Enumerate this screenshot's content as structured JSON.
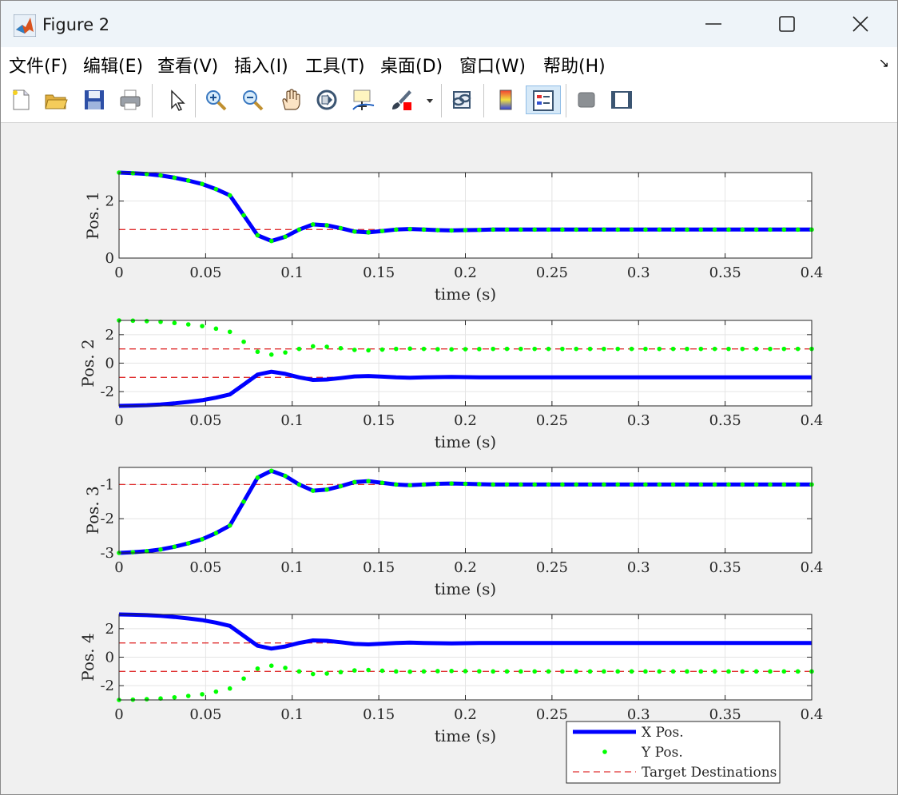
{
  "window": {
    "title": "Figure 2"
  },
  "menu": [
    "文件(F)",
    "编辑(E)",
    "查看(V)",
    "插入(I)",
    "工具(T)",
    "桌面(D)",
    "窗口(W)",
    "帮助(H)"
  ],
  "toolbar": [
    "new-figure-icon",
    "open-file-icon",
    "save-icon",
    "print-icon",
    "pointer-icon",
    "zoom-in-icon",
    "zoom-out-icon",
    "pan-icon",
    "rotate-3d-icon",
    "data-cursor-icon",
    "brush-icon",
    "link-plot-icon",
    "colorbar-icon",
    "legend-icon",
    "hide-plot-tools-icon",
    "show-plot-tools-icon"
  ],
  "colors": {
    "x_series": "#0000ff",
    "y_series": "#00ff00",
    "target": "#e03030"
  },
  "chart_data": [
    {
      "type": "line",
      "ylabel": "Pos. 1",
      "xlabel": "time (s)",
      "xlim": [
        0,
        0.4
      ],
      "ylim": [
        0,
        3
      ],
      "xticks": [
        "0",
        "0.05",
        "0.1",
        "0.15",
        "0.2",
        "0.25",
        "0.3",
        "0.35",
        "0.4"
      ],
      "yticks": [
        0,
        2
      ],
      "grid": true,
      "x": [
        0,
        0.008,
        0.016,
        0.024,
        0.032,
        0.04,
        0.048,
        0.056,
        0.064,
        0.072,
        0.08,
        0.088,
        0.096,
        0.104,
        0.112,
        0.12,
        0.128,
        0.136,
        0.144,
        0.152,
        0.16,
        0.168,
        0.176,
        0.184,
        0.192,
        0.2,
        0.208,
        0.216,
        0.224,
        0.232,
        0.24,
        0.248,
        0.256,
        0.264,
        0.272,
        0.28,
        0.288,
        0.296,
        0.304,
        0.312,
        0.32,
        0.328,
        0.336,
        0.344,
        0.352,
        0.36,
        0.368,
        0.376,
        0.384,
        0.392,
        0.4
      ],
      "series": [
        {
          "name": "X Pos.",
          "values": [
            3,
            2.98,
            2.95,
            2.9,
            2.82,
            2.72,
            2.6,
            2.42,
            2.2,
            1.5,
            0.8,
            0.6,
            0.75,
            1.0,
            1.18,
            1.15,
            1.05,
            0.93,
            0.9,
            0.95,
            1.0,
            1.02,
            1.0,
            0.98,
            0.97,
            0.98,
            0.99,
            1.0,
            1.0,
            1.0,
            1.0,
            1.0,
            1.0,
            1.0,
            1.0,
            1.0,
            1.0,
            1.0,
            1.0,
            1.0,
            1.0,
            1.0,
            1.0,
            1.0,
            1.0,
            1.0,
            1.0,
            1.0,
            1.0,
            1.0,
            1.0
          ]
        },
        {
          "name": "Y Pos.",
          "values": [
            3,
            2.98,
            2.95,
            2.9,
            2.82,
            2.72,
            2.6,
            2.42,
            2.2,
            1.5,
            0.8,
            0.6,
            0.75,
            1.0,
            1.18,
            1.15,
            1.05,
            0.93,
            0.9,
            0.95,
            1.0,
            1.02,
            1.0,
            0.98,
            0.97,
            0.98,
            0.99,
            1.0,
            1.0,
            1.0,
            1.0,
            1.0,
            1.0,
            1.0,
            1.0,
            1.0,
            1.0,
            1.0,
            1.0,
            1.0,
            1.0,
            1.0,
            1.0,
            1.0,
            1.0,
            1.0,
            1.0,
            1.0,
            1.0,
            1.0,
            1.0
          ]
        }
      ],
      "targets": [
        1
      ]
    },
    {
      "type": "line",
      "ylabel": "Pos. 2",
      "xlabel": "time (s)",
      "xlim": [
        0,
        0.4
      ],
      "ylim": [
        -3,
        3
      ],
      "xticks": [
        "0",
        "0.05",
        "0.1",
        "0.15",
        "0.2",
        "0.25",
        "0.3",
        "0.35",
        "0.4"
      ],
      "yticks": [
        -2,
        0,
        2
      ],
      "grid": true,
      "x": [
        0,
        0.008,
        0.016,
        0.024,
        0.032,
        0.04,
        0.048,
        0.056,
        0.064,
        0.072,
        0.08,
        0.088,
        0.096,
        0.104,
        0.112,
        0.12,
        0.128,
        0.136,
        0.144,
        0.152,
        0.16,
        0.168,
        0.176,
        0.184,
        0.192,
        0.2,
        0.208,
        0.216,
        0.224,
        0.232,
        0.24,
        0.248,
        0.256,
        0.264,
        0.272,
        0.28,
        0.288,
        0.296,
        0.304,
        0.312,
        0.32,
        0.328,
        0.336,
        0.344,
        0.352,
        0.36,
        0.368,
        0.376,
        0.384,
        0.392,
        0.4
      ],
      "series": [
        {
          "name": "X Pos.",
          "values": [
            -3,
            -2.98,
            -2.95,
            -2.9,
            -2.82,
            -2.72,
            -2.6,
            -2.42,
            -2.2,
            -1.5,
            -0.8,
            -0.6,
            -0.75,
            -1.0,
            -1.18,
            -1.15,
            -1.05,
            -0.93,
            -0.9,
            -0.95,
            -1.0,
            -1.02,
            -1.0,
            -0.98,
            -0.97,
            -0.98,
            -0.99,
            -1.0,
            -1.0,
            -1.0,
            -1.0,
            -1.0,
            -1.0,
            -1.0,
            -1.0,
            -1.0,
            -1.0,
            -1.0,
            -1.0,
            -1.0,
            -1.0,
            -1.0,
            -1.0,
            -1.0,
            -1.0,
            -1.0,
            -1.0,
            -1.0,
            -1.0,
            -1.0,
            -1.0
          ]
        },
        {
          "name": "Y Pos.",
          "values": [
            3,
            2.98,
            2.95,
            2.9,
            2.82,
            2.72,
            2.6,
            2.42,
            2.2,
            1.5,
            0.8,
            0.6,
            0.75,
            1.0,
            1.18,
            1.15,
            1.05,
            0.93,
            0.9,
            0.95,
            1.0,
            1.02,
            1.0,
            0.98,
            0.97,
            0.98,
            0.99,
            1.0,
            1.0,
            1.0,
            1.0,
            1.0,
            1.0,
            1.0,
            1.0,
            1.0,
            1.0,
            1.0,
            1.0,
            1.0,
            1.0,
            1.0,
            1.0,
            1.0,
            1.0,
            1.0,
            1.0,
            1.0,
            1.0,
            1.0,
            1.0
          ]
        }
      ],
      "targets": [
        1,
        -1
      ]
    },
    {
      "type": "line",
      "ylabel": "Pos. 3",
      "xlabel": "time (s)",
      "xlim": [
        0,
        0.4
      ],
      "ylim": [
        -3,
        -0.5
      ],
      "xticks": [
        "0",
        "0.05",
        "0.1",
        "0.15",
        "0.2",
        "0.25",
        "0.3",
        "0.35",
        "0.4"
      ],
      "yticks": [
        -3,
        -2,
        -1
      ],
      "grid": true,
      "x": [
        0,
        0.008,
        0.016,
        0.024,
        0.032,
        0.04,
        0.048,
        0.056,
        0.064,
        0.072,
        0.08,
        0.088,
        0.096,
        0.104,
        0.112,
        0.12,
        0.128,
        0.136,
        0.144,
        0.152,
        0.16,
        0.168,
        0.176,
        0.184,
        0.192,
        0.2,
        0.208,
        0.216,
        0.224,
        0.232,
        0.24,
        0.248,
        0.256,
        0.264,
        0.272,
        0.28,
        0.288,
        0.296,
        0.304,
        0.312,
        0.32,
        0.328,
        0.336,
        0.344,
        0.352,
        0.36,
        0.368,
        0.376,
        0.384,
        0.392,
        0.4
      ],
      "series": [
        {
          "name": "X Pos.",
          "values": [
            -3,
            -2.98,
            -2.95,
            -2.9,
            -2.82,
            -2.72,
            -2.6,
            -2.42,
            -2.2,
            -1.5,
            -0.8,
            -0.6,
            -0.75,
            -1.0,
            -1.18,
            -1.15,
            -1.05,
            -0.93,
            -0.9,
            -0.95,
            -1.0,
            -1.02,
            -1.0,
            -0.98,
            -0.97,
            -0.98,
            -0.99,
            -1.0,
            -1.0,
            -1.0,
            -1.0,
            -1.0,
            -1.0,
            -1.0,
            -1.0,
            -1.0,
            -1.0,
            -1.0,
            -1.0,
            -1.0,
            -1.0,
            -1.0,
            -1.0,
            -1.0,
            -1.0,
            -1.0,
            -1.0,
            -1.0,
            -1.0,
            -1.0,
            -1.0
          ]
        },
        {
          "name": "Y Pos.",
          "values": [
            -3,
            -2.98,
            -2.95,
            -2.9,
            -2.82,
            -2.72,
            -2.6,
            -2.42,
            -2.2,
            -1.5,
            -0.8,
            -0.6,
            -0.75,
            -1.0,
            -1.18,
            -1.15,
            -1.05,
            -0.93,
            -0.9,
            -0.95,
            -1.0,
            -1.02,
            -1.0,
            -0.98,
            -0.97,
            -0.98,
            -0.99,
            -1.0,
            -1.0,
            -1.0,
            -1.0,
            -1.0,
            -1.0,
            -1.0,
            -1.0,
            -1.0,
            -1.0,
            -1.0,
            -1.0,
            -1.0,
            -1.0,
            -1.0,
            -1.0,
            -1.0,
            -1.0,
            -1.0,
            -1.0,
            -1.0,
            -1.0,
            -1.0,
            -1.0
          ]
        }
      ],
      "targets": [
        -1
      ]
    },
    {
      "type": "line",
      "ylabel": "Pos. 4",
      "xlabel": "time (s)",
      "xlim": [
        0,
        0.4
      ],
      "ylim": [
        -3,
        3
      ],
      "xticks": [
        "0",
        "0.05",
        "0.1",
        "0.15",
        "0.2",
        "0.25",
        "0.3",
        "0.35",
        "0.4"
      ],
      "yticks": [
        -2,
        0,
        2
      ],
      "grid": true,
      "x": [
        0,
        0.008,
        0.016,
        0.024,
        0.032,
        0.04,
        0.048,
        0.056,
        0.064,
        0.072,
        0.08,
        0.088,
        0.096,
        0.104,
        0.112,
        0.12,
        0.128,
        0.136,
        0.144,
        0.152,
        0.16,
        0.168,
        0.176,
        0.184,
        0.192,
        0.2,
        0.208,
        0.216,
        0.224,
        0.232,
        0.24,
        0.248,
        0.256,
        0.264,
        0.272,
        0.28,
        0.288,
        0.296,
        0.304,
        0.312,
        0.32,
        0.328,
        0.336,
        0.344,
        0.352,
        0.36,
        0.368,
        0.376,
        0.384,
        0.392,
        0.4
      ],
      "series": [
        {
          "name": "X Pos.",
          "values": [
            3,
            2.98,
            2.95,
            2.9,
            2.82,
            2.72,
            2.6,
            2.42,
            2.2,
            1.5,
            0.8,
            0.6,
            0.75,
            1.0,
            1.18,
            1.15,
            1.05,
            0.93,
            0.9,
            0.95,
            1.0,
            1.02,
            1.0,
            0.98,
            0.97,
            0.98,
            0.99,
            1.0,
            1.0,
            1.0,
            1.0,
            1.0,
            1.0,
            1.0,
            1.0,
            1.0,
            1.0,
            1.0,
            1.0,
            1.0,
            1.0,
            1.0,
            1.0,
            1.0,
            1.0,
            1.0,
            1.0,
            1.0,
            1.0,
            1.0,
            1.0
          ]
        },
        {
          "name": "Y Pos.",
          "values": [
            -3,
            -2.98,
            -2.95,
            -2.9,
            -2.82,
            -2.72,
            -2.6,
            -2.42,
            -2.2,
            -1.5,
            -0.8,
            -0.6,
            -0.75,
            -1.0,
            -1.18,
            -1.15,
            -1.05,
            -0.93,
            -0.9,
            -0.95,
            -1.0,
            -1.02,
            -1.0,
            -0.98,
            -0.97,
            -0.98,
            -0.99,
            -1.0,
            -1.0,
            -1.0,
            -1.0,
            -1.0,
            -1.0,
            -1.0,
            -1.0,
            -1.0,
            -1.0,
            -1.0,
            -1.0,
            -1.0,
            -1.0,
            -1.0,
            -1.0,
            -1.0,
            -1.0,
            -1.0,
            -1.0,
            -1.0,
            -1.0,
            -1.0,
            -1.0
          ]
        }
      ],
      "targets": [
        1,
        -1
      ]
    }
  ],
  "legend": {
    "placement": "bottom-right",
    "entries": [
      {
        "label": "X Pos.",
        "style": "solid"
      },
      {
        "label": "Y Pos.",
        "style": "dot"
      },
      {
        "label": "Target Destinations",
        "style": "dashed"
      }
    ]
  }
}
